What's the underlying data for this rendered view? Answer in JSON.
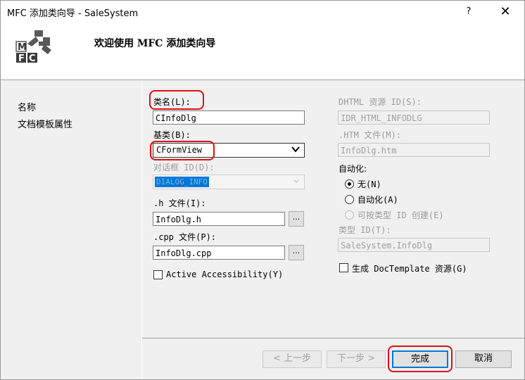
{
  "window": {
    "title": "MFC 添加类向导 - SaleSystem",
    "help_glyph": "?",
    "close_glyph": "✕"
  },
  "header": {
    "heading": "欢迎使用 MFC 添加类向导",
    "logo_letters": [
      "M",
      "F",
      "C"
    ]
  },
  "nav": {
    "items": [
      {
        "label": "名称"
      },
      {
        "label": "文档模板属性"
      }
    ]
  },
  "form": {
    "class_name": {
      "label": "类名(L):",
      "value": "CInfoDlg"
    },
    "base_class": {
      "label": "基类(B):",
      "value": "CFormView"
    },
    "dialog_id": {
      "label": "对话框 ID(D):",
      "value": "DIALOG_INFO"
    },
    "h_file": {
      "label": ".h 文件(I):",
      "value": "InfoDlg.h",
      "browse": "..."
    },
    "cpp_file": {
      "label": ".cpp 文件(P):",
      "value": "InfoDlg.cpp",
      "browse": "..."
    },
    "active_accessibility": {
      "label": "Active Accessibility(Y)",
      "checked": false
    },
    "dhtml_id": {
      "label": "DHTML 资源 ID(S):",
      "value": "IDR_HTML_INFODLG"
    },
    "htm_file": {
      "label": ".HTM 文件(M):",
      "value": "InfoDlg.htm"
    },
    "automation": {
      "label": "自动化:",
      "options": [
        {
          "label": "无(N)",
          "selected": true,
          "enabled": true
        },
        {
          "label": "自动化(A)",
          "selected": false,
          "enabled": true
        },
        {
          "label": "可按类型 ID 创建(E)",
          "selected": false,
          "enabled": false
        }
      ]
    },
    "type_id": {
      "label": "类型 ID(T):",
      "value": "SaleSystem.InfoDlg"
    },
    "doc_template": {
      "label": "生成 DocTemplate 资源(G)",
      "checked": false
    }
  },
  "buttons": {
    "back": "< 上一步",
    "next": "下一步 >",
    "finish": "完成",
    "cancel": "取消"
  },
  "colors": {
    "accent": "#0078d7",
    "annotation": "#e01010"
  }
}
